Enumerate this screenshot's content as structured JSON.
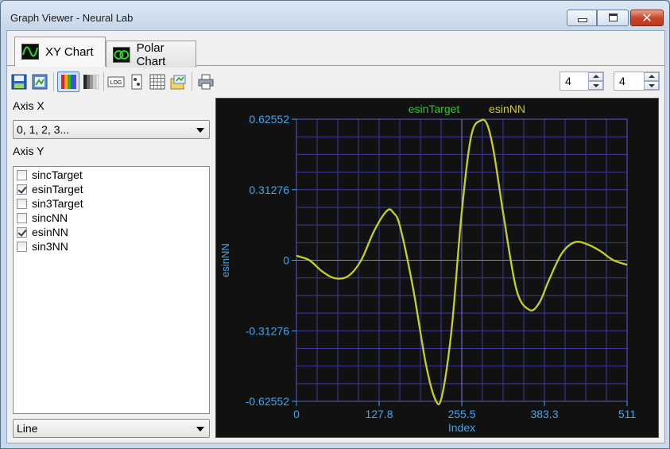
{
  "window": {
    "title": "Graph Viewer - Neural Lab",
    "controls": {
      "minimize": "minimize",
      "maximize": "maximize",
      "close": "✕"
    }
  },
  "tabs": [
    {
      "label": "XY Chart",
      "icon": "xy-chart-icon",
      "active": true
    },
    {
      "label": "Polar Chart",
      "icon": "polar-chart-icon",
      "active": false
    }
  ],
  "toolbar": {
    "buttons": [
      "save-icon",
      "copy-image-icon",
      "color-palette-icon",
      "grayscale-palette-icon",
      "log-scale-icon",
      "scatter-icon",
      "grid-icon",
      "export-icon",
      "print-icon"
    ],
    "pressed": "color-palette-icon",
    "log_label": "LOG"
  },
  "spinners": {
    "x_divisions": "4",
    "y_divisions": "4"
  },
  "axis_x": {
    "label": "Axis X",
    "selected": "0, 1, 2, 3..."
  },
  "axis_y": {
    "label": "Axis Y",
    "items": [
      {
        "label": "sincTarget",
        "checked": false
      },
      {
        "label": "esinTarget",
        "checked": true
      },
      {
        "label": "sin3Target",
        "checked": false
      },
      {
        "label": "sincNN",
        "checked": false
      },
      {
        "label": "esinNN",
        "checked": true
      },
      {
        "label": "sin3NN",
        "checked": false
      }
    ]
  },
  "plot_style": {
    "selected": "Line"
  },
  "colors": {
    "plot_bg": "#111111",
    "grid": "#3a3aa0",
    "axis_text": "#3ea6f0",
    "series_target": "#22cc22",
    "series_nn": "#cccc22"
  },
  "chart_data": {
    "type": "line",
    "xlabel": "Index",
    "ylabel": "esinNN",
    "xlim": [
      0,
      511
    ],
    "ylim": [
      -0.62552,
      0.62552
    ],
    "xticks": [
      "0",
      "127.8",
      "255.5",
      "383.3",
      "511"
    ],
    "yticks": [
      "0.62552",
      "0.31276",
      "0",
      "-0.31276",
      "-0.62552"
    ],
    "grid": true,
    "legend": "top",
    "series": [
      {
        "name": "esinTarget",
        "x": [
          0,
          20,
          40,
          60,
          80,
          100,
          120,
          140,
          150,
          160,
          180,
          200,
          215,
          225,
          240,
          255,
          270,
          285,
          295,
          305,
          320,
          340,
          360,
          375,
          390,
          410,
          430,
          450,
          470,
          490,
          511
        ],
        "y": [
          0.02,
          0.0,
          -0.05,
          -0.08,
          -0.07,
          0.0,
          0.13,
          0.22,
          0.21,
          0.15,
          -0.12,
          -0.46,
          -0.62,
          -0.6,
          -0.3,
          0.2,
          0.55,
          0.62,
          0.6,
          0.48,
          0.2,
          -0.13,
          -0.22,
          -0.19,
          -0.09,
          0.03,
          0.08,
          0.07,
          0.04,
          0.0,
          -0.02
        ]
      },
      {
        "name": "esinNN",
        "x": [
          0,
          20,
          40,
          60,
          80,
          100,
          120,
          140,
          150,
          160,
          180,
          200,
          215,
          225,
          240,
          255,
          270,
          285,
          295,
          305,
          320,
          340,
          360,
          375,
          390,
          410,
          430,
          450,
          470,
          490,
          511
        ],
        "y": [
          0.02,
          0.0,
          -0.05,
          -0.08,
          -0.07,
          0.0,
          0.13,
          0.22,
          0.21,
          0.15,
          -0.12,
          -0.46,
          -0.62,
          -0.6,
          -0.3,
          0.2,
          0.55,
          0.62,
          0.6,
          0.48,
          0.2,
          -0.13,
          -0.22,
          -0.19,
          -0.09,
          0.03,
          0.08,
          0.07,
          0.04,
          0.0,
          -0.02
        ]
      }
    ]
  }
}
